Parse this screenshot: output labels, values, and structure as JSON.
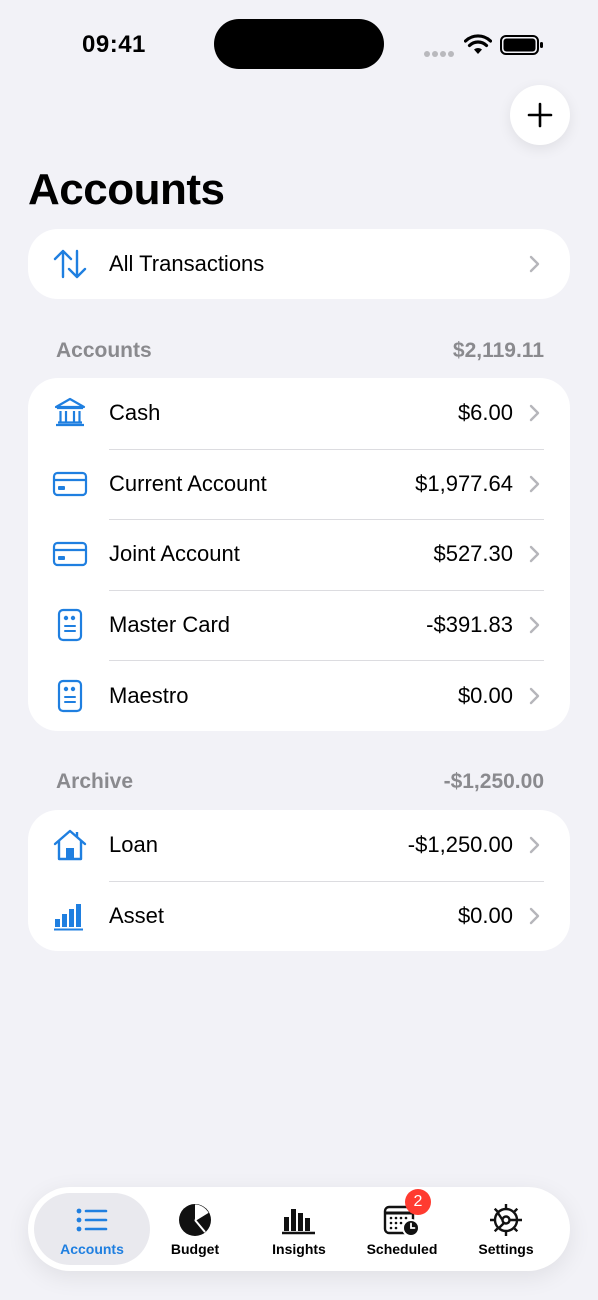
{
  "status_bar": {
    "time": "09:41"
  },
  "header": {
    "title": "Accounts"
  },
  "all_transactions": {
    "label": "All Transactions"
  },
  "accounts_section": {
    "title": "Accounts",
    "total": "$2,119.11",
    "items": [
      {
        "label": "Cash",
        "amount": "$6.00",
        "icon": "bank-icon"
      },
      {
        "label": "Current Account",
        "amount": "$1,977.64",
        "icon": "credit-card-icon"
      },
      {
        "label": "Joint Account",
        "amount": "$527.30",
        "icon": "credit-card-icon"
      },
      {
        "label": "Master Card",
        "amount": "-$391.83",
        "icon": "quote-card-icon"
      },
      {
        "label": "Maestro",
        "amount": "$0.00",
        "icon": "quote-card-icon"
      }
    ]
  },
  "archive_section": {
    "title": "Archive",
    "total": "-$1,250.00",
    "items": [
      {
        "label": "Loan",
        "amount": "-$1,250.00",
        "icon": "house-icon"
      },
      {
        "label": "Asset",
        "amount": "$0.00",
        "icon": "bar-chart-icon"
      }
    ]
  },
  "tab_bar": {
    "tabs": [
      {
        "label": "Accounts",
        "icon": "list-icon",
        "active": true
      },
      {
        "label": "Budget",
        "icon": "pie-chart-icon"
      },
      {
        "label": "Insights",
        "icon": "bar-chart-icon"
      },
      {
        "label": "Scheduled",
        "icon": "calendar-clock-icon",
        "badge": "2"
      },
      {
        "label": "Settings",
        "icon": "gear-icon"
      }
    ]
  },
  "colors": {
    "accent": "#1f7fe0",
    "background": "#f2f2f7",
    "badge": "#ff3b30",
    "secondary_text": "#8a8a8e"
  }
}
